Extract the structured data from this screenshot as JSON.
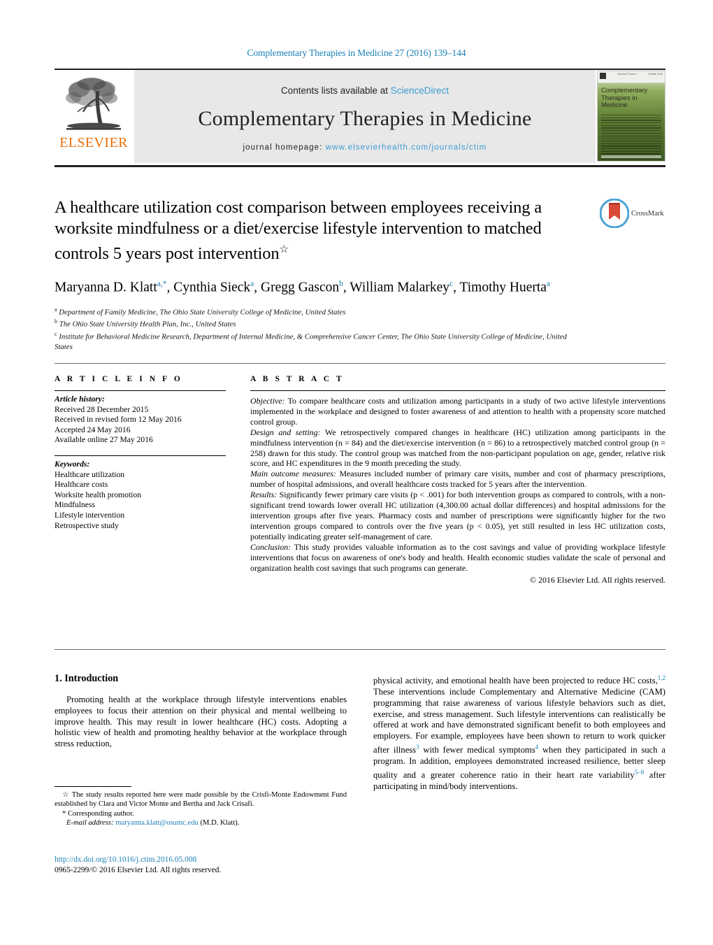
{
  "running_head": "Complementary Therapies in Medicine 27 (2016) 139–144",
  "masthead": {
    "publisher_name": "ELSEVIER",
    "contents_prefix": "Contents lists available at ",
    "contents_link": "ScienceDirect",
    "journal_title": "Complementary Therapies in Medicine",
    "homepage_prefix": "journal homepage: ",
    "homepage_url": "www.elsevierhealth.com/journals/ctim",
    "cover": {
      "title_line1": "Complementary",
      "title_line2": "Therapies in",
      "title_line3": "Medicine",
      "top_left": "Volume 27 Issue 1",
      "top_right": "October 2016"
    }
  },
  "article": {
    "title": "A healthcare utilization cost comparison between employees receiving a worksite mindfulness or a diet/exercise lifestyle intervention to matched controls 5 years post intervention",
    "title_marker": "☆",
    "authors_line1_pre": "Maryanna D. Klatt",
    "authors": [
      {
        "name": "Maryanna D. Klatt",
        "sup": "a,*"
      },
      {
        "name": "Cynthia Sieck",
        "sup": "a"
      },
      {
        "name": "Gregg Gascon",
        "sup": "b"
      },
      {
        "name": "William Malarkey",
        "sup": "c"
      },
      {
        "name": "Timothy Huerta",
        "sup": "a"
      }
    ],
    "affiliations": [
      {
        "mark": "a",
        "text": "Department of Family Medicine, The Ohio State University College of Medicine, United States"
      },
      {
        "mark": "b",
        "text": "The Ohio State University Health Plan, Inc., United States"
      },
      {
        "mark": "c",
        "text": "Institute for Behavioral Medicine Research, Department of Internal Medicine, & Comprehensive Cancer Center, The Ohio State University College of Medicine, United States"
      }
    ],
    "crossmark_label": "CrossMark"
  },
  "article_info": {
    "heading": "A R T I C L E   I N F O",
    "history_label": "Article history:",
    "history": [
      "Received 28 December 2015",
      "Received in revised form 12 May 2016",
      "Accepted 24 May 2016",
      "Available online 27 May 2016"
    ],
    "keywords_label": "Keywords:",
    "keywords": [
      "Healthcare utilization",
      "Healthcare costs",
      "Worksite health promotion",
      "Mindfulness",
      "Lifestyle intervention",
      "Retrospective study"
    ]
  },
  "abstract": {
    "heading": "A B S T R A C T",
    "sections": [
      {
        "label": "Objective:",
        "text": " To compare healthcare costs and utilization among participants in a study of two active lifestyle interventions implemented in the workplace and designed to foster awareness of and attention to health with a propensity score matched control group."
      },
      {
        "label": "Design and setting:",
        "text": " We retrospectively compared changes in healthcare (HC) utilization among participants in the mindfulness intervention (n = 84) and the diet/exercise intervention (n = 86) to a retrospectively matched control group (n = 258) drawn for this study. The control group was matched from the non-participant population on age, gender, relative risk score, and HC expenditures in the 9 month preceding the study."
      },
      {
        "label": "Main outcome measures:",
        "text": " Measures included number of primary care visits, number and cost of pharmacy prescriptions, number of hospital admissions, and overall healthcare costs tracked for 5 years after the intervention."
      },
      {
        "label": "Results:",
        "text": " Significantly fewer primary care visits (p < .001) for both intervention groups as compared to controls, with a non-significant trend towards lower overall HC utilization (4,300.00 actual dollar differences) and hospital admissions for the intervention groups after five years. Pharmacy costs and number of prescriptions were significantly higher for the two intervention groups compared to controls over the five years (p < 0.05), yet still resulted in less HC utilization costs, potentially indicating greater self-management of care."
      },
      {
        "label": "Conclusion:",
        "text": " This study provides valuable information as to the cost savings and value of providing workplace lifestyle interventions that focus on awareness of one's body and health. Health economic studies validate the scale of personal and organization health cost savings that such programs can generate."
      }
    ],
    "copyright": "© 2016 Elsevier Ltd. All rights reserved."
  },
  "body": {
    "section_number_title": "1. Introduction",
    "left_paragraph": "Promoting health at the workplace through lifestyle interventions enables employees to focus their attention on their physical and mental wellbeing to improve health. This may result in lower healthcare (HC) costs. Adopting a holistic view of health and promoting healthy behavior at the workplace through stress reduction,",
    "right_paragraph_part1": "physical activity, and emotional health have been projected to reduce HC costs,",
    "right_ref1": "1,2",
    "right_paragraph_part2": " These interventions include Complementary and Alternative Medicine (CAM) programming that raise awareness of various lifestyle behaviors such as diet, exercise, and stress management. Such lifestyle interventions can realistically be offered at work and have demonstrated significant benefit to both employees and employers. For example, employees have been shown to return to work quicker after illness",
    "right_ref2": "3",
    "right_paragraph_part3": " with fewer medical symptoms",
    "right_ref3": "4",
    "right_paragraph_part4": " when they participated in such a program. In addition, employees demonstrated increased resilience, better sleep quality and a greater coherence ratio in their heart rate variability",
    "right_ref4": "5–8",
    "right_paragraph_part5": " after participating in mind/body interventions."
  },
  "footnotes": {
    "star_marker": "☆",
    "star_text": " The study results reported here were made possible by the Crisfi-Monte Endowment Fund established by Clara and Victor Monte and Bertha and Jack Crisafi.",
    "corresponding_marker": "*",
    "corresponding_text": " Corresponding author.",
    "email_label": "E-mail address:",
    "email": "maryanna.klatt@osumc.edu",
    "email_suffix": " (M.D. Klatt)."
  },
  "bottom": {
    "doi": "http://dx.doi.org/10.1016/j.ctim.2016.05.008",
    "issn_line": "0965-2299/© 2016 Elsevier Ltd. All rights reserved."
  },
  "colors": {
    "link_blue": "#1a7fb5",
    "sciencedirect_blue": "#3c9cd4",
    "elsevier_orange": "#eb6e08",
    "banner_gray": "#e8e8e8"
  }
}
